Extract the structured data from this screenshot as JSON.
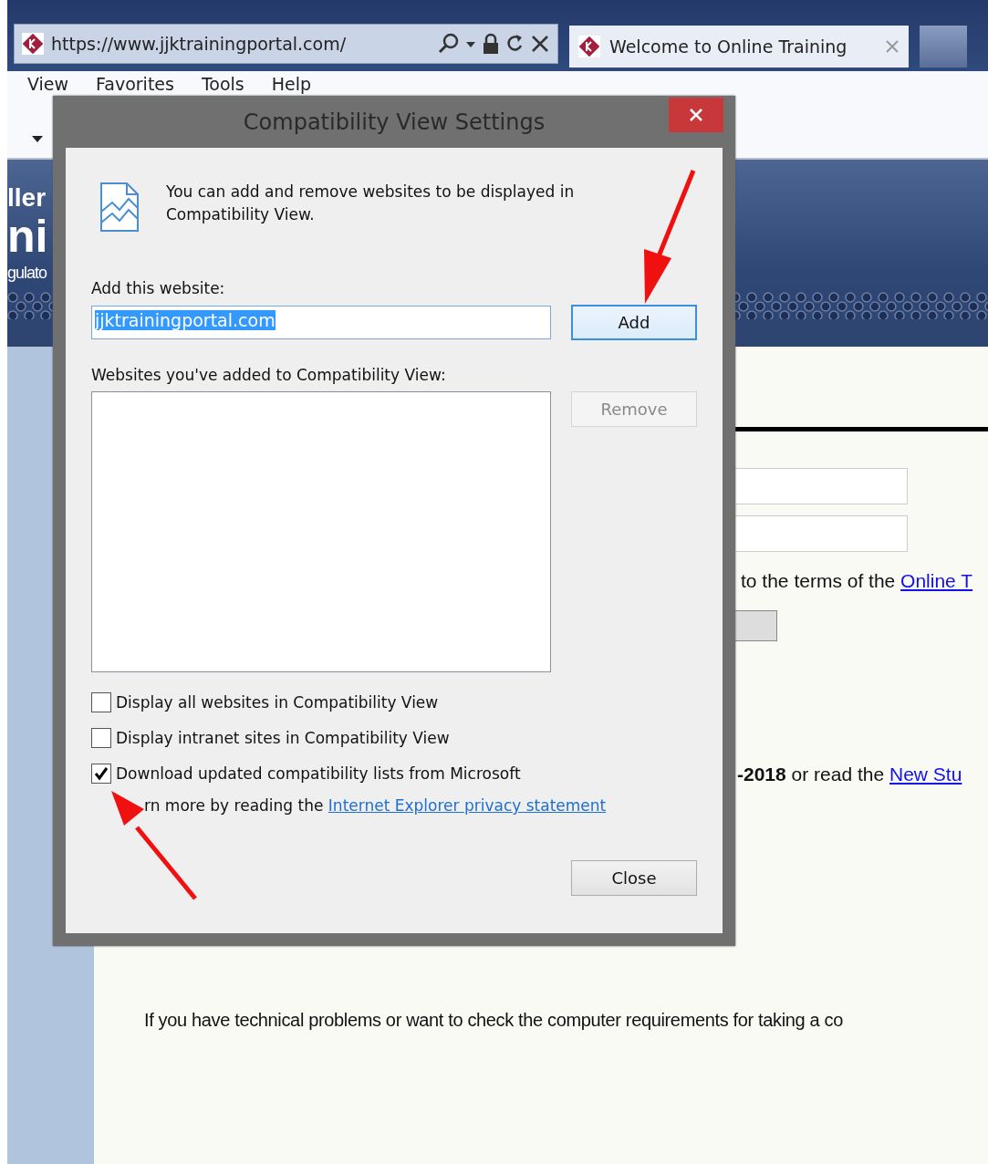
{
  "browser": {
    "address_bar": {
      "url": "https://www.jjktrainingportal.com/"
    },
    "tabs": [
      {
        "label": "Welcome to Online Training",
        "selected": true
      }
    ],
    "menu": [
      "View",
      "Favorites",
      "Tools",
      "Help"
    ]
  },
  "page": {
    "header_fragments": [
      "ller",
      "ni",
      "gulato"
    ],
    "terms_text": "to the terms of the",
    "terms_link": "Online T",
    "news_text": "**-2018** or read the",
    "news_link": "New Stu",
    "help_text": "If you have technical problems or want to check the computer requirements for taking a co"
  },
  "dialog": {
    "title": "Compatibility View Settings",
    "intro": "You can add and remove websites to be displayed in Compatibility View.",
    "add_label": "Add this website:",
    "add_value": "jjktrainingportal.com",
    "add_button": "Add",
    "list_label": "Websites you've added to Compatibility View:",
    "remove_button": {
      "label": "Remove",
      "disabled": true
    },
    "options": [
      {
        "label": "Display all websites in Compatibility View",
        "checked": false
      },
      {
        "label": "Display intranet sites in Compatibility View",
        "checked": false
      },
      {
        "label": "Download updated compatibility lists from Microsoft",
        "checked": true
      }
    ],
    "learn_more": "rn more by reading the",
    "privacy_link": "Internet Explorer privacy statement",
    "close_button": "Close"
  }
}
